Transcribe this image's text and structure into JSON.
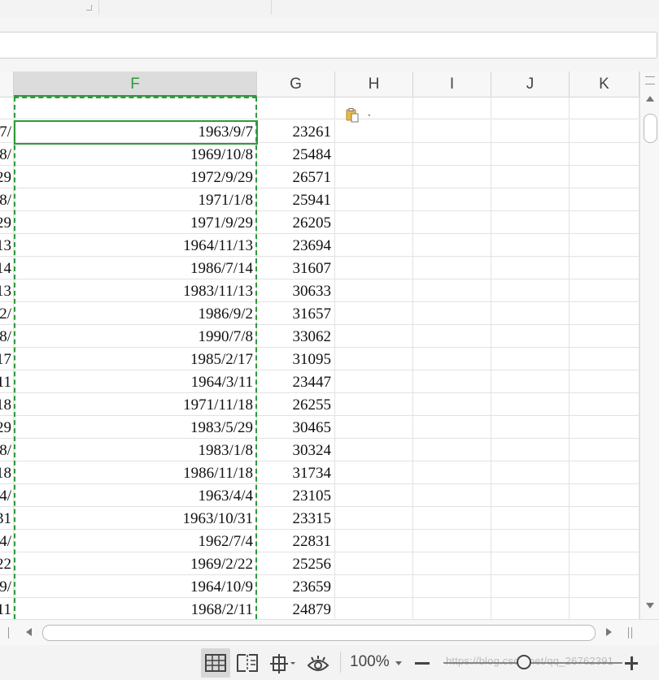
{
  "columns": [
    "F",
    "G",
    "H",
    "I",
    "J",
    "K"
  ],
  "active_column": "F",
  "rows": [
    {
      "e": "/7",
      "f": "1963/9/7",
      "g": "23261"
    },
    {
      "e": "/8",
      "f": "1969/10/8",
      "g": "25484"
    },
    {
      "e": "29",
      "f": "1972/9/29",
      "g": "26571"
    },
    {
      "e": "/8",
      "f": "1971/1/8",
      "g": "25941"
    },
    {
      "e": "29",
      "f": "1971/9/29",
      "g": "26205"
    },
    {
      "e": "13",
      "f": "1964/11/13",
      "g": "23694"
    },
    {
      "e": "14",
      "f": "1986/7/14",
      "g": "31607"
    },
    {
      "e": "13",
      "f": "1983/11/13",
      "g": "30633"
    },
    {
      "e": "/2",
      "f": "1986/9/2",
      "g": "31657"
    },
    {
      "e": "/8",
      "f": "1990/7/8",
      "g": "33062"
    },
    {
      "e": "17",
      "f": "1985/2/17",
      "g": "31095"
    },
    {
      "e": "11",
      "f": "1964/3/11",
      "g": "23447"
    },
    {
      "e": "18",
      "f": "1971/11/18",
      "g": "26255"
    },
    {
      "e": "29",
      "f": "1983/5/29",
      "g": "30465"
    },
    {
      "e": "/8",
      "f": "1983/1/8",
      "g": "30324"
    },
    {
      "e": "18",
      "f": "1986/11/18",
      "g": "31734"
    },
    {
      "e": "/4",
      "f": "1963/4/4",
      "g": "23105"
    },
    {
      "e": "31",
      "f": "1963/10/31",
      "g": "23315"
    },
    {
      "e": "/4",
      "f": "1962/7/4",
      "g": "22831"
    },
    {
      "e": "22",
      "f": "1969/2/22",
      "g": "25256"
    },
    {
      "e": "/9",
      "f": "1964/10/9",
      "g": "23659"
    },
    {
      "e": "11",
      "f": "1968/2/11",
      "g": "24879"
    }
  ],
  "statusbar": {
    "zoom": "100%",
    "watermark": "https://blog.csdn.net/qq_26762391"
  },
  "icons": {
    "paste_options": "clipboard-paste-icon",
    "normal_view": "grid-view-icon",
    "page_break": "page-break-view-icon",
    "reading_mode": "crosshair-view-icon",
    "eye_protection": "eye-icon"
  },
  "colors": {
    "accent": "#2e9a3a"
  }
}
